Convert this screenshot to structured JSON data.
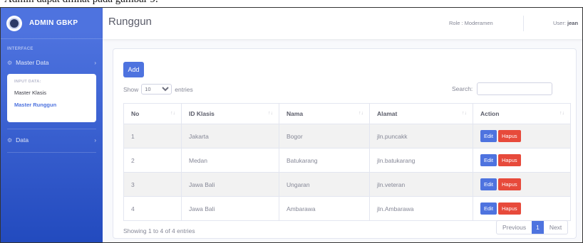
{
  "caption": "Admin dapat dilihat pada gambar 9.",
  "brand": {
    "title": "ADMIN GBKP"
  },
  "sidebar": {
    "heading": "INTERFACE",
    "master_data": "Master Data",
    "menu_heading": "INPUT DATA:",
    "menu_items": [
      "Master Klasis",
      "Master Runggun"
    ],
    "data": "Data"
  },
  "topbar": {
    "title": "Runggun",
    "role": "Role : Moderamen",
    "user_label": "User:",
    "user_name": "jean"
  },
  "card": {
    "add_label": "Add",
    "show_label": "Show",
    "entries_value": "10",
    "entries_label": "entries",
    "search_label": "Search:",
    "search_value": ""
  },
  "table": {
    "headers": [
      "No",
      "ID Klasis",
      "Nama",
      "Alamat",
      "Action"
    ],
    "rows": [
      [
        "1",
        "Jakarta",
        "Bogor",
        "jln.puncakk"
      ],
      [
        "2",
        "Medan",
        "Batukarang",
        "jln.batukarang"
      ],
      [
        "3",
        "Jawa Bali",
        "Ungaran",
        "jln.veteran"
      ],
      [
        "4",
        "Jawa Bali",
        "Ambarawa",
        "jln.Ambarawa"
      ]
    ],
    "edit_label": "Edit",
    "delete_label": "Hapus"
  },
  "footer": {
    "showing": "Showing 1 to 4 of 4 entries",
    "previous": "Previous",
    "page": "1",
    "next": "Next"
  },
  "colors": {
    "primary": "#4e73df",
    "danger": "#e74a3b"
  }
}
